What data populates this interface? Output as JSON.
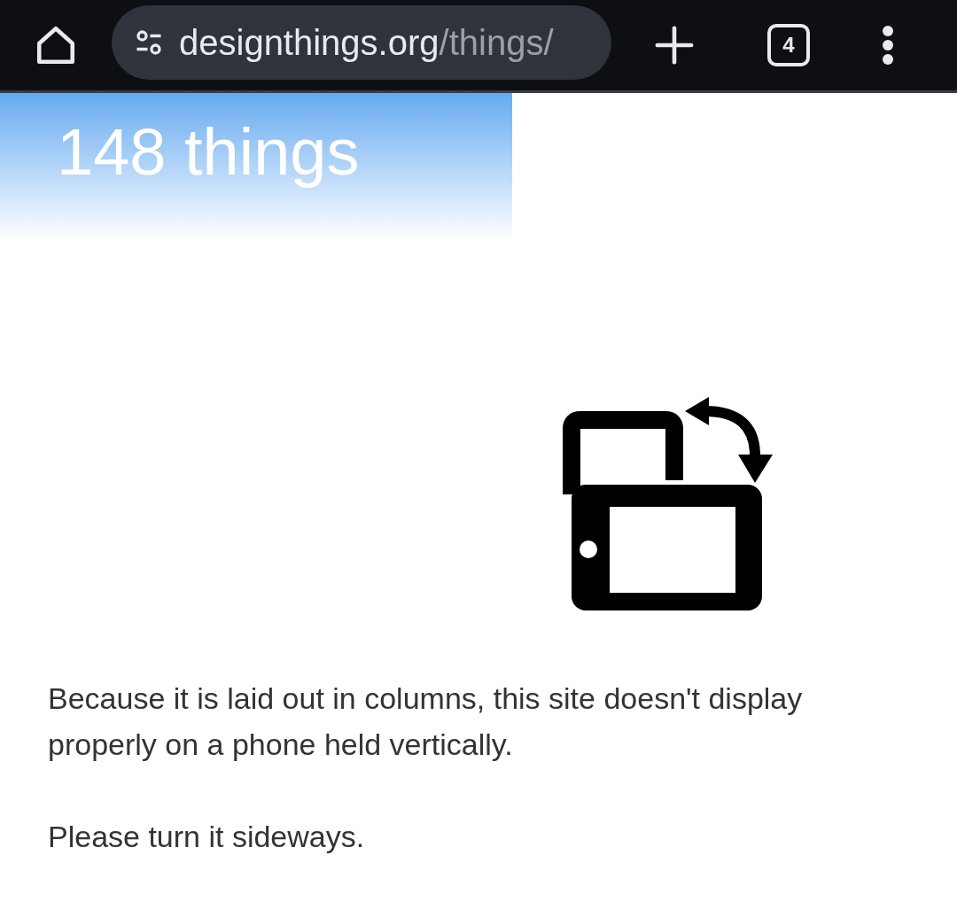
{
  "browser_bar": {
    "url": {
      "domain": "designthings.org",
      "path": "/things/"
    },
    "tab_count": "4"
  },
  "header": {
    "title": "148 things"
  },
  "message": {
    "paragraphs": [
      "Because it is laid out in columns, this site doesn't display properly on a phone held vertically.",
      "Please turn it sideways."
    ]
  }
}
